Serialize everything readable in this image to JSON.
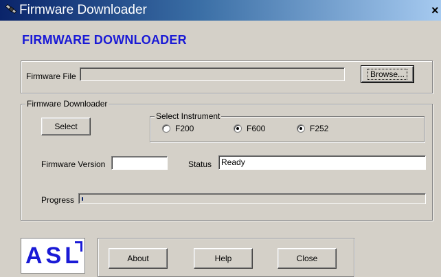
{
  "window": {
    "title": "Firmware Downloader",
    "close_glyph": "×",
    "icon": "satellite-icon"
  },
  "heading": "FIRMWARE DOWNLOADER",
  "file_row": {
    "label": "Firmware File",
    "value": "",
    "browse_label": "Browse..."
  },
  "downloader": {
    "legend": "Firmware Downloader",
    "select_label": "Select",
    "instrument": {
      "legend": "Select Instrument",
      "options": [
        {
          "label": "F200",
          "checked": false
        },
        {
          "label": "F600",
          "checked": true
        },
        {
          "label": "F252",
          "checked": true
        }
      ]
    },
    "version_label": "Firmware Version",
    "version_value": "",
    "status_label": "Status",
    "status_value": "Ready",
    "progress_label": "Progress",
    "progress_fraction": 0.005
  },
  "footer": {
    "logo_text": "ASL",
    "about_label": "About",
    "help_label": "Help",
    "close_label": "Close"
  },
  "colors": {
    "face": "#d4d0c8",
    "title_start": "#0a246a",
    "title_end": "#a6caf0",
    "heading": "#1a1ad6"
  }
}
